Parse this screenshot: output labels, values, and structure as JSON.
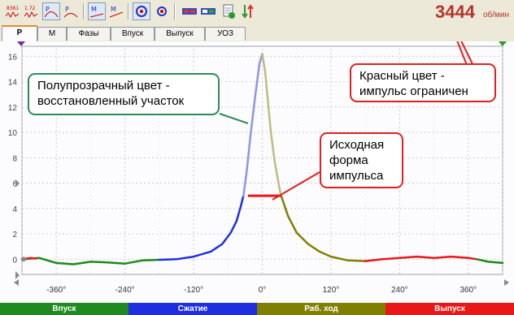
{
  "rpm": {
    "value": "3444",
    "unit": "об/мин"
  },
  "toolbar": {
    "buttons": [
      {
        "icon": "waveform-icon"
      },
      {
        "icon": "waveform-value-icon"
      },
      {
        "icon": "pressure-icon"
      },
      {
        "icon": "pressure-small-icon"
      },
      {
        "icon": "marker-icon"
      },
      {
        "icon": "marker-move-icon"
      },
      {
        "icon": "rotate-icon"
      },
      {
        "icon": "rotate-small-icon"
      },
      {
        "icon": "switch-red-icon"
      },
      {
        "icon": "switch-blue-icon"
      },
      {
        "icon": "report-icon"
      },
      {
        "icon": "sort-icon"
      }
    ]
  },
  "tabs": [
    {
      "label": "P",
      "active": true
    },
    {
      "label": "M",
      "active": false
    },
    {
      "label": "Фазы",
      "active": false
    },
    {
      "label": "Впуск",
      "active": false
    },
    {
      "label": "Выпуск",
      "active": false
    },
    {
      "label": "УОЗ",
      "active": false
    }
  ],
  "callouts": {
    "restored": {
      "line1": "Полупрозрачный цвет -",
      "line2": "восстановленный участок",
      "color": "#2e8b57"
    },
    "limited": {
      "line1": "Красный цвет -",
      "line2": "импульс ограничен",
      "color": "#e02020"
    },
    "original": {
      "line1": "Исходная",
      "line2": "форма",
      "line3": "импульса",
      "color": "#e02020"
    }
  },
  "phases": [
    {
      "label": "Впуск",
      "color": "#1f8a1f"
    },
    {
      "label": "Сжатие",
      "color": "#1f2fe0"
    },
    {
      "label": "Раб. ход",
      "color": "#808000"
    },
    {
      "label": "Выпуск",
      "color": "#e81818"
    }
  ],
  "chart_data": {
    "type": "line",
    "x_ticks": [
      "-360°",
      "-240°",
      "-120°",
      "0°",
      "120°",
      "240°",
      "360°"
    ],
    "y_ticks": [
      "0",
      "2",
      "4",
      "6",
      "8",
      "10",
      "12",
      "14",
      "16"
    ],
    "xlim": [
      -420,
      420
    ],
    "ylim": [
      -1.2,
      16.6
    ],
    "limit_value": 5,
    "peak": {
      "x": 0,
      "y": 16.2
    },
    "series": [
      {
        "phase": "intake",
        "color": "#1a8a1a",
        "points": [
          [
            -420,
            0.0
          ],
          [
            -390,
            0.1
          ],
          [
            -360,
            -0.3
          ],
          [
            -330,
            -0.4
          ],
          [
            -300,
            -0.2
          ],
          [
            -270,
            -0.25
          ],
          [
            -240,
            -0.35
          ],
          [
            -210,
            -0.1
          ],
          [
            -180,
            -0.05
          ]
        ]
      },
      {
        "phase": "compression",
        "color": "#1f2fe0",
        "points": [
          [
            -180,
            -0.05
          ],
          [
            -150,
            0.0
          ],
          [
            -120,
            0.2
          ],
          [
            -90,
            0.6
          ],
          [
            -70,
            1.2
          ],
          [
            -55,
            2.1
          ],
          [
            -45,
            3.0
          ],
          [
            -38,
            4.1
          ],
          [
            -33,
            5.0
          ]
        ]
      },
      {
        "phase": "compression-restored",
        "color": "#8c95e8",
        "points": [
          [
            -33,
            5.0
          ],
          [
            -27,
            7.0
          ],
          [
            -20,
            10.0
          ],
          [
            -12,
            13.0
          ],
          [
            -5,
            15.4
          ],
          [
            0,
            16.2
          ]
        ]
      },
      {
        "phase": "power-restored",
        "color": "#bdbd7f",
        "points": [
          [
            0,
            16.2
          ],
          [
            5,
            14.8
          ],
          [
            10,
            12.4
          ],
          [
            15,
            10.0
          ],
          [
            22,
            7.6
          ],
          [
            30,
            5.6
          ],
          [
            33,
            5.0
          ]
        ]
      },
      {
        "phase": "power",
        "color": "#808000",
        "points": [
          [
            33,
            5.0
          ],
          [
            45,
            3.4
          ],
          [
            60,
            2.1
          ],
          [
            80,
            1.2
          ],
          [
            100,
            0.6
          ],
          [
            120,
            0.2
          ],
          [
            150,
            -0.1
          ],
          [
            180,
            -0.15
          ]
        ]
      },
      {
        "phase": "exhaust",
        "color": "#e81818",
        "points": [
          [
            180,
            -0.15
          ],
          [
            210,
            0.0
          ],
          [
            240,
            0.1
          ],
          [
            270,
            0.2
          ],
          [
            300,
            0.1
          ],
          [
            330,
            0.2
          ],
          [
            360,
            0.1
          ],
          [
            375,
            0.0
          ]
        ]
      },
      {
        "phase": "intake-2",
        "color": "#1a8a1a",
        "points": [
          [
            375,
            0.0
          ],
          [
            395,
            -0.2
          ],
          [
            420,
            -0.3
          ]
        ]
      },
      {
        "phase": "exhaust-start",
        "color": "#e81818",
        "points": [
          [
            -420,
            0.0
          ],
          [
            -405,
            0.1
          ],
          [
            -395,
            0.05
          ]
        ]
      }
    ]
  }
}
